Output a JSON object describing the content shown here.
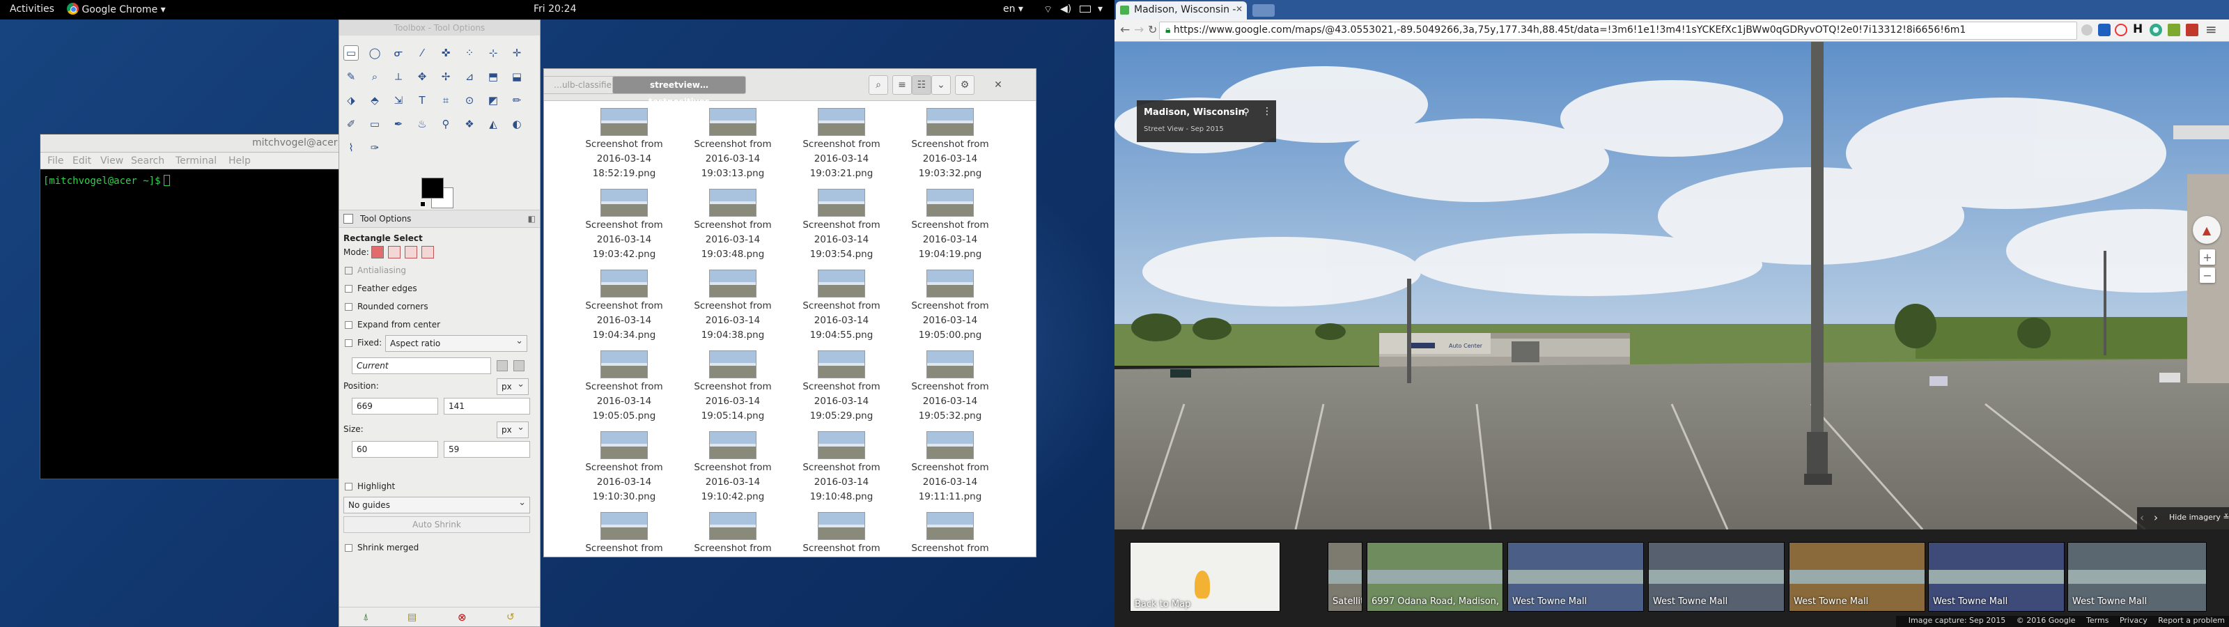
{
  "topbar": {
    "activities": "Activities",
    "app_menu": "Google Chrome ▾",
    "clock": "Fri 20:24",
    "keyboard": "en ▾",
    "status_icons": [
      "wifi-icon",
      "volume-icon",
      "battery-icon",
      "power-menu-icon"
    ]
  },
  "terminal": {
    "title": "mitchvogel@acer:~",
    "menu": [
      "File",
      "Edit",
      "View",
      "Search",
      "Terminal",
      "Help"
    ],
    "prompt": "[mitchvogel@acer ~]$"
  },
  "gimp": {
    "title": "Toolbox - Tool Options",
    "tab_label": "Tool Options",
    "tool_name": "Rectangle Select",
    "mode_label": "Mode:",
    "antialiasing": "Antialiasing",
    "feather_edges": "Feather edges",
    "rounded_corners": "Rounded corners",
    "expand_from_center": "Expand from center",
    "fixed_label": "Fixed:",
    "fixed_value": "Aspect ratio",
    "current_value": "Current",
    "position_label": "Position:",
    "position_unit": "px",
    "position_x": "669",
    "position_y": "141",
    "size_label": "Size:",
    "size_unit": "px",
    "size_w": "60",
    "size_h": "59",
    "highlight": "Highlight",
    "guides": "No guides",
    "auto_shrink": "Auto Shrink",
    "shrink_merged": "Shrink merged",
    "fg_color": "#000000",
    "bg_color": "#ffffff"
  },
  "files": {
    "crumb_prev": "…ulb-classifier",
    "crumb_current": "streetview…testpositives",
    "items": [
      {
        "l1": "Screenshot from",
        "l2": "2016-03-14",
        "l3": "18:52:19.png"
      },
      {
        "l1": "Screenshot from",
        "l2": "2016-03-14",
        "l3": "19:03:13.png"
      },
      {
        "l1": "Screenshot from",
        "l2": "2016-03-14",
        "l3": "19:03:21.png"
      },
      {
        "l1": "Screenshot from",
        "l2": "2016-03-14",
        "l3": "19:03:32.png"
      },
      {
        "l1": "Screenshot from",
        "l2": "2016-03-14",
        "l3": "19:03:42.png"
      },
      {
        "l1": "Screenshot from",
        "l2": "2016-03-14",
        "l3": "19:03:48.png"
      },
      {
        "l1": "Screenshot from",
        "l2": "2016-03-14",
        "l3": "19:03:54.png"
      },
      {
        "l1": "Screenshot from",
        "l2": "2016-03-14",
        "l3": "19:04:19.png"
      },
      {
        "l1": "Screenshot from",
        "l2": "2016-03-14",
        "l3": "19:04:34.png"
      },
      {
        "l1": "Screenshot from",
        "l2": "2016-03-14",
        "l3": "19:04:38.png"
      },
      {
        "l1": "Screenshot from",
        "l2": "2016-03-14",
        "l3": "19:04:55.png"
      },
      {
        "l1": "Screenshot from",
        "l2": "2016-03-14",
        "l3": "19:05:00.png"
      },
      {
        "l1": "Screenshot from",
        "l2": "2016-03-14",
        "l3": "19:05:05.png"
      },
      {
        "l1": "Screenshot from",
        "l2": "2016-03-14",
        "l3": "19:05:14.png"
      },
      {
        "l1": "Screenshot from",
        "l2": "2016-03-14",
        "l3": "19:05:29.png"
      },
      {
        "l1": "Screenshot from",
        "l2": "2016-03-14",
        "l3": "19:05:32.png"
      },
      {
        "l1": "Screenshot from",
        "l2": "2016-03-14",
        "l3": "19:10:30.png"
      },
      {
        "l1": "Screenshot from",
        "l2": "2016-03-14",
        "l3": "19:10:42.png"
      },
      {
        "l1": "Screenshot from",
        "l2": "2016-03-14",
        "l3": "19:10:48.png"
      },
      {
        "l1": "Screenshot from",
        "l2": "2016-03-14",
        "l3": "19:11:11.png"
      },
      {
        "l1": "Screenshot from",
        "l2": "",
        "l3": ""
      },
      {
        "l1": "Screenshot from",
        "l2": "",
        "l3": ""
      },
      {
        "l1": "Screenshot from",
        "l2": "",
        "l3": ""
      },
      {
        "l1": "Screenshot from",
        "l2": "",
        "l3": ""
      }
    ]
  },
  "chrome": {
    "tab_title": "Madison, Wisconsin -",
    "url": "https://www.google.com/maps/@43.0553021,-89.5049266,3a,75y,177.34h,88.45t/data=!3m6!1e1!3m4!1sYCKEfXc1jBWw0qGDRyvOTQ!2e0!7i13312!8i6656!6m1"
  },
  "streetview": {
    "place": "Madison, Wisconsin",
    "date": "Street View - Sep 2015",
    "sign": "Auto Center",
    "hide_imagery": "Hide imagery",
    "back_to_map": "Back to Map",
    "thumbs": [
      "Satellite",
      "6997 Odana Road, Madison,",
      "West Towne Mall",
      "West Towne Mall",
      "West Towne Mall",
      "West Towne Mall",
      "West Towne Mall"
    ],
    "footer": [
      "Image capture: Sep 2015",
      "© 2016 Google",
      "Terms",
      "Privacy",
      "Report a problem"
    ]
  }
}
